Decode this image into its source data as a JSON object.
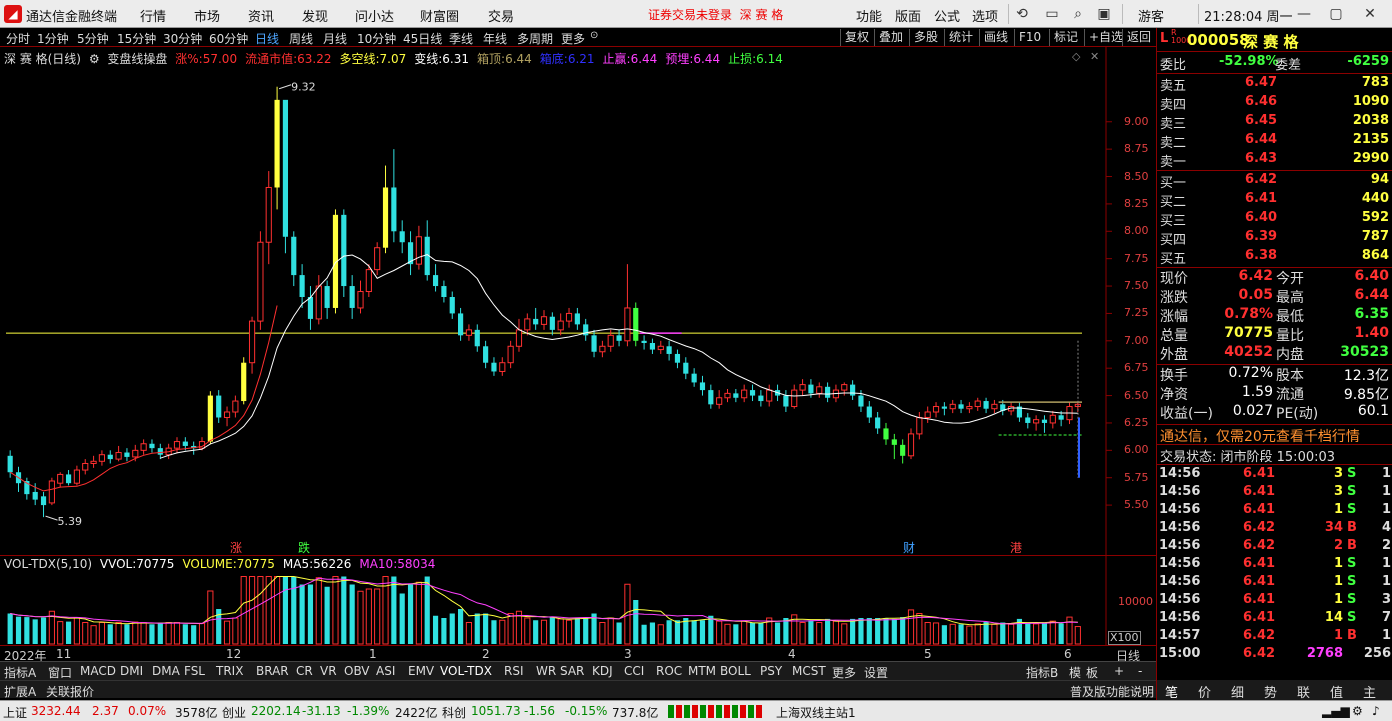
{
  "titlebar": {
    "app_title": "通达信金融终端",
    "menus": [
      "行情",
      "市场",
      "资讯",
      "发现",
      "问小达",
      "财富圈",
      "交易"
    ],
    "warning": "证券交易未登录",
    "warning_stock": "深 赛 格",
    "right_menus": [
      "功能",
      "版面",
      "公式",
      "选项"
    ],
    "user": "游客",
    "clock": "21:28:04 周一"
  },
  "periods": [
    "分时",
    "1分钟",
    "5分钟",
    "15分钟",
    "30分钟",
    "60分钟",
    "日线",
    "周线",
    "月线",
    "10分钟",
    "45日线",
    "季线",
    "年线",
    "多周期",
    "更多"
  ],
  "selected_period": "日线",
  "toolbar_right": [
    "复权",
    "叠加",
    "多股",
    "统计",
    "画线",
    "F10",
    "标记",
    "+自选",
    "返回"
  ],
  "infobar": {
    "stock": "深 赛 格(日线)",
    "indicator": "变盘线操盘",
    "items": [
      {
        "label": "涨%:",
        "value": "57.00",
        "color": "#ff3030"
      },
      {
        "label": "流通市值:",
        "value": "63.22",
        "color": "#ff3030"
      },
      {
        "label": "多空线:",
        "value": "7.07",
        "color": "#ffff40"
      },
      {
        "label": "变线:",
        "value": "6.31",
        "color": "#ffffff"
      },
      {
        "label": "箱顶:",
        "value": "6.44",
        "color": "#b0a060"
      },
      {
        "label": "箱底:",
        "value": "6.21",
        "color": "#3030ff"
      },
      {
        "label": "止赢:",
        "value": "6.44",
        "color": "#ff40ff"
      },
      {
        "label": "预埋:",
        "value": "6.44",
        "color": "#ff40ff"
      },
      {
        "label": "止损:",
        "value": "6.14",
        "color": "#40ff40"
      }
    ]
  },
  "price_axis": [
    "9.00",
    "8.75",
    "8.50",
    "8.25",
    "8.00",
    "7.75",
    "7.50",
    "7.25",
    "7.00",
    "6.75",
    "6.50",
    "6.25",
    "6.00",
    "5.75",
    "5.50"
  ],
  "high_label": "9.32",
  "low_label": "5.39",
  "event_markers": [
    {
      "text": "涨",
      "color": "#ff4040"
    },
    {
      "text": "跌",
      "color": "#40ff40"
    },
    {
      "text": "财",
      "color": "#40a0ff"
    },
    {
      "text": "港",
      "color": "#ff4040"
    }
  ],
  "volinfo": {
    "name": "VOL-TDX(5,10)",
    "items": [
      {
        "label": "VVOL:",
        "value": "70775",
        "color": "#ffffff"
      },
      {
        "label": "VOLUME:",
        "value": "70775",
        "color": "#ffff40"
      },
      {
        "label": "MA5:",
        "value": "56226",
        "color": "#ffffff"
      },
      {
        "label": "MA10:",
        "value": "58034",
        "color": "#ff40ff"
      }
    ]
  },
  "vol_axis": "10000",
  "vol_unit": "X100",
  "date_labels": [
    "2022年",
    "11",
    "12",
    "1",
    "2",
    "3",
    "4",
    "5",
    "6"
  ],
  "date_right": "日线",
  "indicators": [
    "指标A",
    "窗口",
    "MACD",
    "DMI",
    "DMA",
    "FSL",
    "TRIX",
    "BRAR",
    "CR",
    "VR",
    "OBV",
    "ASI",
    "EMV",
    "VOL-TDX",
    "RSI",
    "WR",
    "SAR",
    "KDJ",
    "CCI",
    "ROC",
    "MTM",
    "BOLL",
    "PSY",
    "MCST",
    "更多",
    "设置"
  ],
  "ind_right": [
    "指标B",
    "模",
    "板",
    "+",
    "-"
  ],
  "ext": [
    "扩展A",
    "关联报价"
  ],
  "ext_right": "普及版功能说明",
  "quote": {
    "code": "000058",
    "name": "深 赛 格",
    "weibi_label": "委比",
    "weibi": "-52.98%",
    "weicha_label": "委差",
    "weicha": "-6259",
    "sell": [
      {
        "label": "卖五",
        "price": "6.47",
        "vol": "783"
      },
      {
        "label": "卖四",
        "price": "6.46",
        "vol": "1090"
      },
      {
        "label": "卖三",
        "price": "6.45",
        "vol": "2038"
      },
      {
        "label": "卖二",
        "price": "6.44",
        "vol": "2135"
      },
      {
        "label": "卖一",
        "price": "6.43",
        "vol": "2990"
      }
    ],
    "buy": [
      {
        "label": "买一",
        "price": "6.42",
        "vol": "94"
      },
      {
        "label": "买二",
        "price": "6.41",
        "vol": "440"
      },
      {
        "label": "买三",
        "price": "6.40",
        "vol": "592"
      },
      {
        "label": "买四",
        "price": "6.39",
        "vol": "787"
      },
      {
        "label": "买五",
        "price": "6.38",
        "vol": "864"
      }
    ],
    "stats": [
      {
        "k1": "现价",
        "v1": "6.42",
        "c1": "#ff3030",
        "k2": "今开",
        "v2": "6.40",
        "c2": "#ff3030"
      },
      {
        "k1": "涨跌",
        "v1": "0.05",
        "c1": "#ff3030",
        "k2": "最高",
        "v2": "6.44",
        "c2": "#ff3030"
      },
      {
        "k1": "涨幅",
        "v1": "0.78%",
        "c1": "#ff3030",
        "k2": "最低",
        "v2": "6.35",
        "c2": "#40ff40"
      },
      {
        "k1": "总量",
        "v1": "70775",
        "c1": "#ffff40",
        "k2": "量比",
        "v2": "1.40",
        "c2": "#ff3030"
      },
      {
        "k1": "外盘",
        "v1": "40252",
        "c1": "#ff3030",
        "k2": "内盘",
        "v2": "30523",
        "c2": "#40ff40"
      }
    ],
    "stats2": [
      {
        "k1": "换手",
        "v1": "0.72%",
        "k2": "股本",
        "v2": "12.3亿"
      },
      {
        "k1": "净资",
        "v1": "1.59",
        "k2": "流通",
        "v2": "9.85亿"
      },
      {
        "k1": "收益(一)",
        "v1": "0.027",
        "k2": "PE(动)",
        "v2": "60.1"
      }
    ],
    "ad": "通达信，仅需20元查看千档行情",
    "trade_status": "交易状态: 闭市阶段 15:00:03",
    "ticks": [
      {
        "t": "14:56",
        "p": "6.41",
        "v": "3",
        "d": "S",
        "n": "1"
      },
      {
        "t": "14:56",
        "p": "6.41",
        "v": "3",
        "d": "S",
        "n": "1"
      },
      {
        "t": "14:56",
        "p": "6.41",
        "v": "1",
        "d": "S",
        "n": "1"
      },
      {
        "t": "14:56",
        "p": "6.42",
        "v": "34",
        "d": "B",
        "n": "4"
      },
      {
        "t": "14:56",
        "p": "6.42",
        "v": "2",
        "d": "B",
        "n": "2"
      },
      {
        "t": "14:56",
        "p": "6.41",
        "v": "1",
        "d": "S",
        "n": "1"
      },
      {
        "t": "14:56",
        "p": "6.41",
        "v": "1",
        "d": "S",
        "n": "1"
      },
      {
        "t": "14:56",
        "p": "6.41",
        "v": "1",
        "d": "S",
        "n": "3"
      },
      {
        "t": "14:56",
        "p": "6.41",
        "v": "14",
        "d": "S",
        "n": "7"
      },
      {
        "t": "14:57",
        "p": "6.42",
        "v": "1",
        "d": "B",
        "n": "1"
      },
      {
        "t": "15:00",
        "p": "6.42",
        "v": "2768",
        "d": "",
        "n": "256"
      }
    ]
  },
  "right_tabs": [
    "笔",
    "价",
    "细",
    "势",
    "联",
    "值",
    "主"
  ],
  "statusbar": {
    "sh_label": "上证",
    "sh_val": "3232.44",
    "sh_chg": "2.37",
    "sh_pct": "0.07%",
    "sh_amt": "3578亿",
    "cy_label": "创业",
    "cy_val": "2202.14",
    "cy_chg": "-31.13",
    "cy_pct": "-1.39%",
    "cy_amt": "2422亿",
    "kc_label": "科创",
    "kc_val": "1051.73",
    "kc_chg": "-1.56",
    "kc_pct": "-0.15%",
    "kc_amt": "737.8亿",
    "server": "上海双线主站1"
  },
  "colors": {
    "up": "#ff3030",
    "down": "#40ff40",
    "neutral": "#ffffff",
    "yellow": "#ffff40",
    "cyan": "#30e0e0"
  },
  "chart_data": {
    "type": "candlestick",
    "ylim": [
      5.3,
      9.5
    ],
    "candles": [
      [
        5.95,
        5.8,
        6.0,
        5.75
      ],
      [
        5.8,
        5.7,
        5.85,
        5.62
      ],
      [
        5.72,
        5.6,
        5.75,
        5.55
      ],
      [
        5.62,
        5.55,
        5.7,
        5.5
      ],
      [
        5.58,
        5.5,
        5.62,
        5.39
      ],
      [
        5.52,
        5.72,
        5.75,
        5.5
      ],
      [
        5.7,
        5.78,
        5.8,
        5.66
      ],
      [
        5.78,
        5.7,
        5.82,
        5.68
      ],
      [
        5.7,
        5.82,
        5.86,
        5.68
      ],
      [
        5.82,
        5.88,
        5.92,
        5.78
      ],
      [
        5.88,
        5.9,
        5.95,
        5.84
      ],
      [
        5.9,
        5.96,
        6.0,
        5.86
      ],
      [
        5.96,
        5.92,
        6.0,
        5.88
      ],
      [
        5.92,
        5.98,
        6.04,
        5.9
      ],
      [
        5.98,
        5.94,
        6.02,
        5.9
      ],
      [
        5.94,
        6.0,
        6.05,
        5.9
      ],
      [
        6.0,
        6.06,
        6.1,
        5.96
      ],
      [
        6.06,
        6.02,
        6.1,
        5.98
      ],
      [
        6.02,
        5.96,
        6.06,
        5.92
      ],
      [
        5.96,
        6.02,
        6.06,
        5.92
      ],
      [
        6.02,
        6.08,
        6.12,
        5.98
      ],
      [
        6.08,
        6.04,
        6.12,
        6.0
      ],
      [
        6.04,
        6.02,
        6.08,
        5.96
      ],
      [
        6.02,
        6.08,
        6.12,
        6.0
      ],
      [
        6.08,
        6.5,
        6.54,
        6.06
      ],
      [
        6.5,
        6.3,
        6.55,
        6.25
      ],
      [
        6.3,
        6.35,
        6.4,
        6.22
      ],
      [
        6.35,
        6.45,
        6.5,
        6.3
      ],
      [
        6.45,
        6.8,
        6.85,
        6.42
      ],
      [
        6.8,
        7.18,
        7.22,
        6.7
      ],
      [
        7.18,
        7.9,
        8.0,
        7.1
      ],
      [
        7.9,
        8.4,
        8.55,
        7.7
      ],
      [
        8.4,
        9.2,
        9.32,
        8.2
      ],
      [
        9.2,
        7.95,
        9.1,
        7.8
      ],
      [
        7.95,
        7.6,
        8.0,
        7.5
      ],
      [
        7.6,
        7.4,
        7.7,
        7.3
      ],
      [
        7.4,
        7.2,
        7.5,
        7.1
      ],
      [
        7.2,
        7.5,
        7.6,
        7.15
      ],
      [
        7.5,
        7.3,
        7.55,
        7.2
      ],
      [
        7.3,
        8.15,
        8.2,
        7.25
      ],
      [
        8.15,
        7.5,
        8.2,
        7.4
      ],
      [
        7.5,
        7.3,
        7.6,
        7.2
      ],
      [
        7.3,
        7.45,
        7.55,
        7.25
      ],
      [
        7.45,
        7.65,
        7.7,
        7.4
      ],
      [
        7.65,
        7.85,
        7.9,
        7.6
      ],
      [
        7.85,
        8.4,
        8.6,
        7.8
      ],
      [
        8.4,
        8.0,
        8.75,
        7.9
      ],
      [
        8.0,
        7.9,
        8.1,
        7.8
      ],
      [
        7.9,
        7.7,
        8.0,
        7.6
      ],
      [
        7.7,
        7.95,
        8.05,
        7.65
      ],
      [
        7.95,
        7.6,
        8.1,
        7.55
      ],
      [
        7.6,
        7.5,
        7.7,
        7.45
      ],
      [
        7.5,
        7.4,
        7.55,
        7.35
      ],
      [
        7.4,
        7.25,
        7.45,
        7.2
      ],
      [
        7.25,
        7.05,
        7.3,
        7.0
      ],
      [
        7.05,
        7.1,
        7.15,
        7.0
      ],
      [
        7.1,
        6.95,
        7.15,
        6.9
      ],
      [
        6.95,
        6.8,
        7.0,
        6.75
      ],
      [
        6.8,
        6.72,
        6.85,
        6.68
      ],
      [
        6.72,
        6.8,
        6.85,
        6.68
      ],
      [
        6.8,
        6.95,
        7.0,
        6.75
      ],
      [
        6.95,
        7.1,
        7.2,
        6.9
      ],
      [
        7.1,
        7.2,
        7.25,
        7.05
      ],
      [
        7.2,
        7.15,
        7.3,
        7.1
      ],
      [
        7.15,
        7.22,
        7.28,
        7.1
      ],
      [
        7.22,
        7.1,
        7.26,
        7.05
      ],
      [
        7.1,
        7.18,
        7.25,
        7.05
      ],
      [
        7.18,
        7.25,
        7.3,
        7.12
      ],
      [
        7.25,
        7.15,
        7.3,
        7.1
      ],
      [
        7.15,
        7.05,
        7.2,
        7.0
      ],
      [
        7.05,
        6.9,
        7.1,
        6.85
      ],
      [
        6.9,
        6.95,
        7.0,
        6.85
      ],
      [
        6.95,
        7.05,
        7.1,
        6.9
      ],
      [
        7.05,
        7.0,
        7.1,
        6.95
      ],
      [
        7.0,
        7.3,
        7.7,
        6.95
      ],
      [
        7.3,
        7.0,
        7.35,
        6.95
      ],
      [
        7.0,
        6.98,
        7.05,
        6.92
      ],
      [
        6.98,
        6.92,
        7.02,
        6.88
      ],
      [
        6.92,
        6.95,
        7.0,
        6.88
      ],
      [
        6.95,
        6.88,
        7.0,
        6.82
      ],
      [
        6.88,
        6.8,
        6.92,
        6.75
      ],
      [
        6.8,
        6.7,
        6.85,
        6.65
      ],
      [
        6.7,
        6.62,
        6.75,
        6.58
      ],
      [
        6.62,
        6.55,
        6.68,
        6.5
      ],
      [
        6.55,
        6.42,
        6.6,
        6.38
      ],
      [
        6.42,
        6.48,
        6.55,
        6.38
      ],
      [
        6.48,
        6.52,
        6.56,
        6.44
      ],
      [
        6.52,
        6.48,
        6.56,
        6.44
      ],
      [
        6.48,
        6.55,
        6.6,
        6.44
      ],
      [
        6.55,
        6.5,
        6.6,
        6.45
      ],
      [
        6.5,
        6.45,
        6.55,
        6.4
      ],
      [
        6.45,
        6.55,
        6.6,
        6.4
      ],
      [
        6.55,
        6.5,
        6.6,
        6.45
      ],
      [
        6.5,
        6.4,
        6.55,
        6.35
      ],
      [
        6.4,
        6.55,
        6.6,
        6.38
      ],
      [
        6.55,
        6.6,
        6.65,
        6.5
      ],
      [
        6.6,
        6.52,
        6.65,
        6.48
      ],
      [
        6.52,
        6.58,
        6.62,
        6.48
      ],
      [
        6.58,
        6.48,
        6.62,
        6.44
      ],
      [
        6.48,
        6.55,
        6.6,
        6.44
      ],
      [
        6.55,
        6.6,
        6.62,
        6.5
      ],
      [
        6.6,
        6.5,
        6.64,
        6.46
      ],
      [
        6.5,
        6.4,
        6.55,
        6.35
      ],
      [
        6.4,
        6.3,
        6.45,
        6.25
      ],
      [
        6.3,
        6.2,
        6.35,
        6.15
      ],
      [
        6.2,
        6.1,
        6.25,
        6.05
      ],
      [
        6.1,
        6.05,
        6.15,
        5.92
      ],
      [
        6.05,
        5.95,
        6.1,
        5.88
      ],
      [
        5.95,
        6.15,
        6.2,
        5.92
      ],
      [
        6.15,
        6.3,
        6.35,
        6.1
      ],
      [
        6.3,
        6.35,
        6.4,
        6.25
      ],
      [
        6.35,
        6.4,
        6.44,
        6.3
      ],
      [
        6.4,
        6.38,
        6.44,
        6.32
      ],
      [
        6.38,
        6.42,
        6.46,
        6.34
      ],
      [
        6.42,
        6.38,
        6.46,
        6.34
      ],
      [
        6.38,
        6.4,
        6.44,
        6.34
      ],
      [
        6.4,
        6.45,
        6.48,
        6.36
      ],
      [
        6.45,
        6.38,
        6.48,
        6.34
      ],
      [
        6.38,
        6.42,
        6.46,
        6.34
      ],
      [
        6.42,
        6.36,
        6.46,
        6.32
      ],
      [
        6.36,
        6.4,
        6.44,
        6.32
      ],
      [
        6.4,
        6.3,
        6.44,
        6.26
      ],
      [
        6.3,
        6.25,
        6.34,
        6.2
      ],
      [
        6.25,
        6.28,
        6.32,
        6.18
      ],
      [
        6.28,
        6.25,
        6.32,
        6.16
      ],
      [
        6.25,
        6.32,
        6.36,
        6.2
      ],
      [
        6.32,
        6.28,
        6.36,
        6.22
      ],
      [
        6.28,
        6.4,
        6.44,
        6.24
      ],
      [
        6.4,
        6.42,
        6.44,
        6.35
      ]
    ],
    "vol_ylim": [
      0,
      14000
    ]
  }
}
